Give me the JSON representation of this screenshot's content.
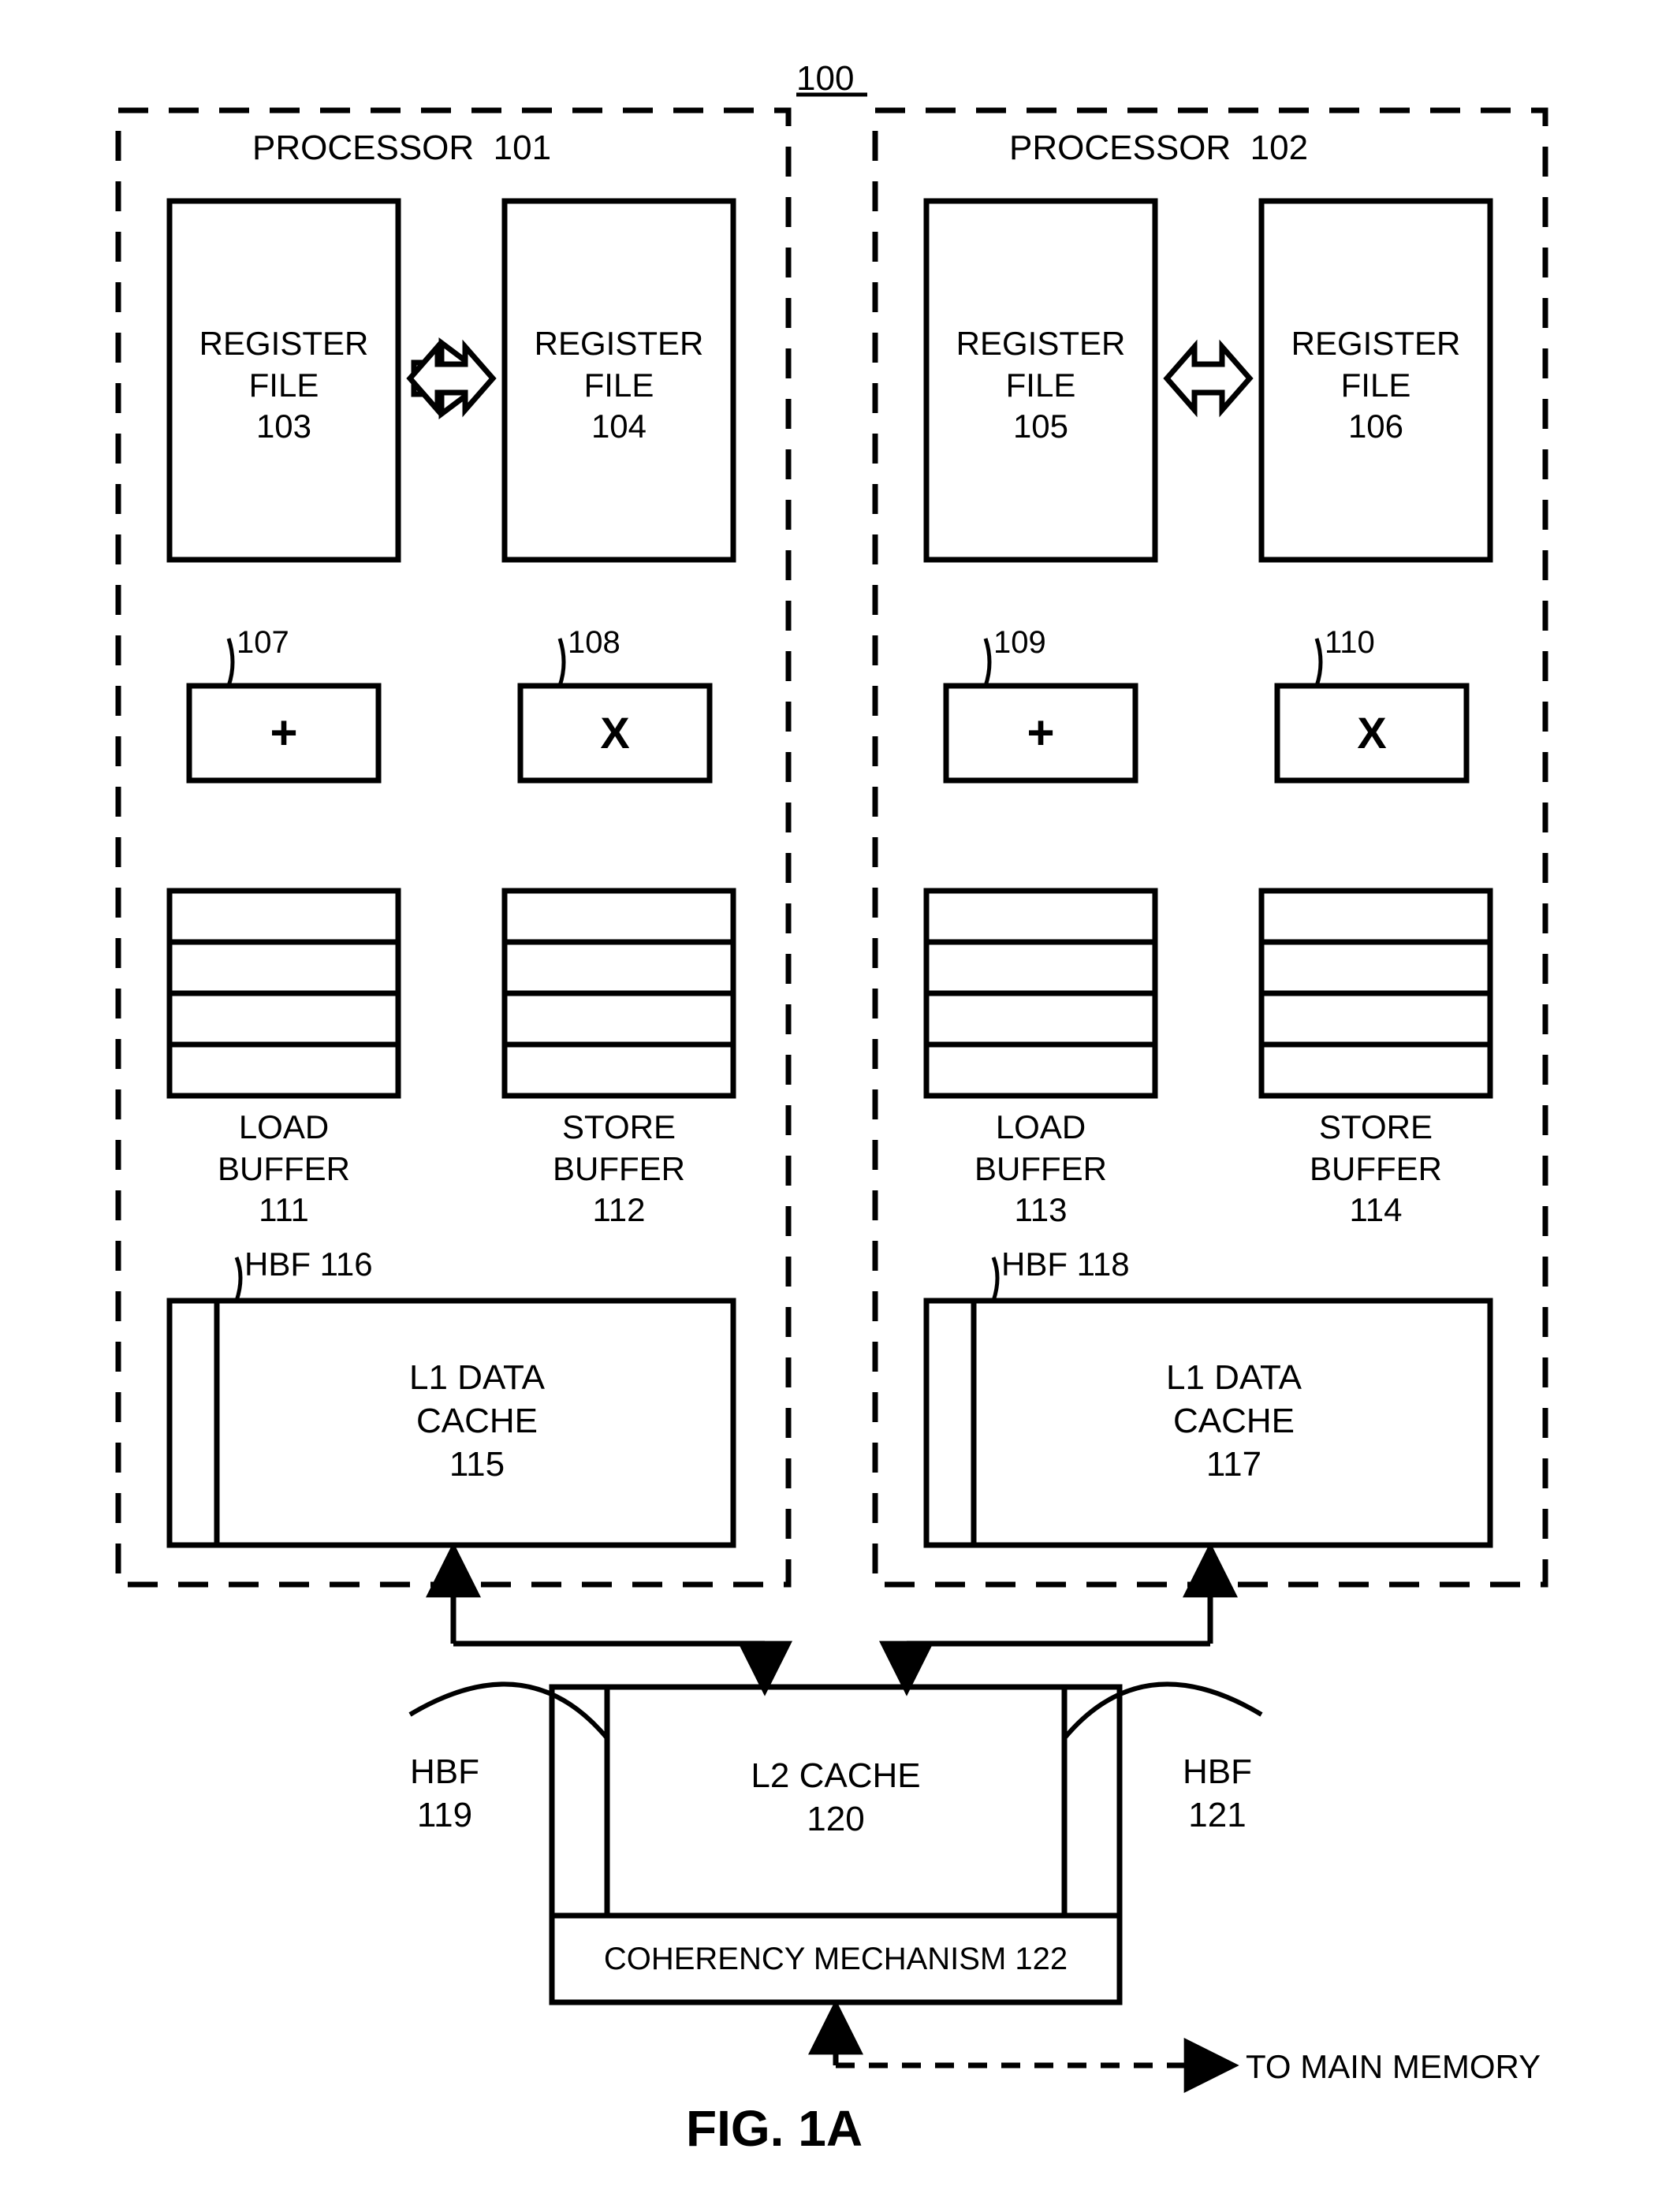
{
  "figure_ref": "100",
  "figure_title": "FIG. 1A",
  "proc1": {
    "title": "PROCESSOR",
    "ref": "101"
  },
  "proc2": {
    "title": "PROCESSOR",
    "ref": "102"
  },
  "regfile": {
    "l1": "REGISTER",
    "l2": "FILE",
    "r103": "103",
    "r104": "104",
    "r105": "105",
    "r106": "106"
  },
  "alu": {
    "plus": "+",
    "mult": "X",
    "r107": "107",
    "r108": "108",
    "r109": "109",
    "r110": "110"
  },
  "buffer": {
    "load_l1": "LOAD",
    "load_l2": "BUFFER",
    "store_l1": "STORE",
    "store_l2": "BUFFER",
    "r111": "111",
    "r112": "112",
    "r113": "113",
    "r114": "114"
  },
  "l1cache": {
    "l1": "L1 DATA",
    "l2": "CACHE",
    "r115": "115",
    "r117": "117"
  },
  "hbf": {
    "label": "HBF",
    "r116": "116",
    "r118": "118",
    "r119": "119",
    "r121": "121"
  },
  "l2cache": {
    "l1": "L2 CACHE",
    "r120": "120"
  },
  "coherency": {
    "l1": "COHERENCY MECHANISM",
    "r122": "122"
  },
  "to_main_memory": "TO MAIN MEMORY"
}
